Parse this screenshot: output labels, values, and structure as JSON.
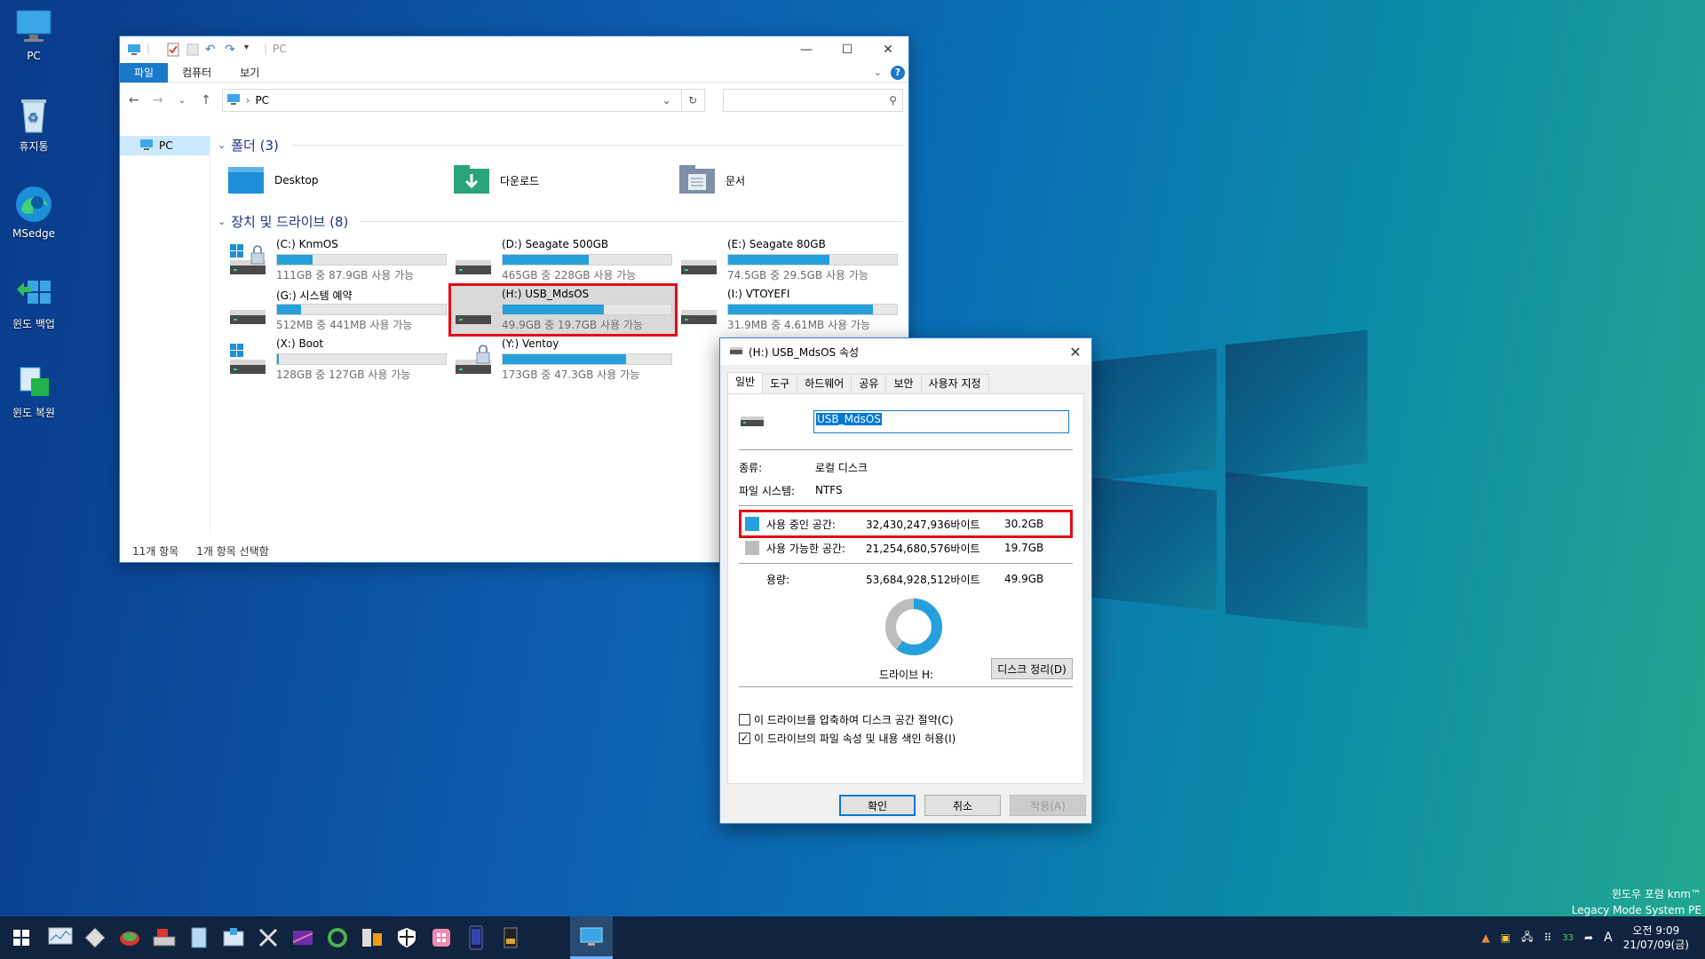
{
  "desktop": {
    "icons": [
      {
        "label": "PC",
        "icon": "pc-icon"
      },
      {
        "label": "휴지통",
        "icon": "recycle-bin-icon"
      },
      {
        "label": "MSedge",
        "icon": "edge-icon"
      },
      {
        "label": "윈도 백업",
        "icon": "backup-icon"
      },
      {
        "label": "윈도 복원",
        "icon": "restore-icon"
      }
    ],
    "watermark_line1": "윈도우 포럼 knm™",
    "watermark_line2": "Legacy Mode System PE"
  },
  "explorer": {
    "title": "PC",
    "ribbon_tabs": [
      "파일",
      "컴퓨터",
      "보기"
    ],
    "address": "PC",
    "nav_item": "PC",
    "folders_group": "폴더 (3)",
    "folders": [
      "Desktop",
      "다운로드",
      "문서"
    ],
    "drives_group": "장치 및 드라이브 (8)",
    "drives": [
      {
        "name": "(C:) KnmOS",
        "free": "111GB 중 87.9GB 사용 가능",
        "used_fraction": 0.21,
        "kind": "windows-locked"
      },
      {
        "name": "(D:) Seagate 500GB",
        "free": "465GB 중 228GB 사용 가능",
        "used_fraction": 0.51,
        "kind": "hdd"
      },
      {
        "name": "(E:) Seagate 80GB",
        "free": "74.5GB 중 29.5GB 사용 가능",
        "used_fraction": 0.6,
        "kind": "hdd"
      },
      {
        "name": "(G:) 시스템 예약",
        "free": "512MB 중 441MB 사용 가능",
        "used_fraction": 0.14,
        "kind": "hdd"
      },
      {
        "name": "(H:) USB_MdsOS",
        "free": "49.9GB 중 19.7GB 사용 가능",
        "used_fraction": 0.6,
        "kind": "hdd",
        "selected": true
      },
      {
        "name": "(I:) VTOYEFI",
        "free": "31.9MB 중 4.61MB 사용 가능",
        "used_fraction": 0.86,
        "kind": "hdd"
      },
      {
        "name": "(X:) Boot",
        "free": "128GB 중 127GB 사용 가능",
        "used_fraction": 0.01,
        "kind": "windows"
      },
      {
        "name": "(Y:) Ventoy",
        "free": "173GB 중 47.3GB 사용 가능",
        "used_fraction": 0.73,
        "kind": "locked"
      }
    ],
    "status_items": "11개 항목",
    "status_selected": "1개 항목 선택함"
  },
  "dialog": {
    "title": "(H:) USB_MdsOS 속성",
    "tabs": [
      "일반",
      "도구",
      "하드웨어",
      "공유",
      "보안",
      "사용자 지정"
    ],
    "name_value": "USB_MdsOS",
    "type_label": "종류:",
    "type_value": "로컬 디스크",
    "fs_label": "파일 시스템:",
    "fs_value": "NTFS",
    "used_label": "사용 중인 공간:",
    "used_bytes": "32,430,247,936바이트",
    "used_gb": "30.2GB",
    "free_label": "사용 가능한 공간:",
    "free_bytes": "21,254,680,576바이트",
    "free_gb": "19.7GB",
    "cap_label": "용량:",
    "cap_bytes": "53,684,928,512바이트",
    "cap_gb": "49.9GB",
    "drive_label": "드라이브 H:",
    "used_fraction": 0.604,
    "cleanup_button": "디스크 정리(D)",
    "compress_label": "이 드라이브를 압축하여 디스크 공간 절약(C)",
    "index_label": "이 드라이브의 파일 속성 및 내용 색인 허용(I)",
    "ok": "확인",
    "cancel": "취소",
    "apply": "적용(A)",
    "colors": {
      "used": "#26a0da",
      "free": "#bcbcbc"
    }
  },
  "taskbar": {
    "clock_time": "오전 9:09",
    "clock_date": "21/07/09(금)",
    "tray_badge": "33",
    "ime": "A"
  }
}
